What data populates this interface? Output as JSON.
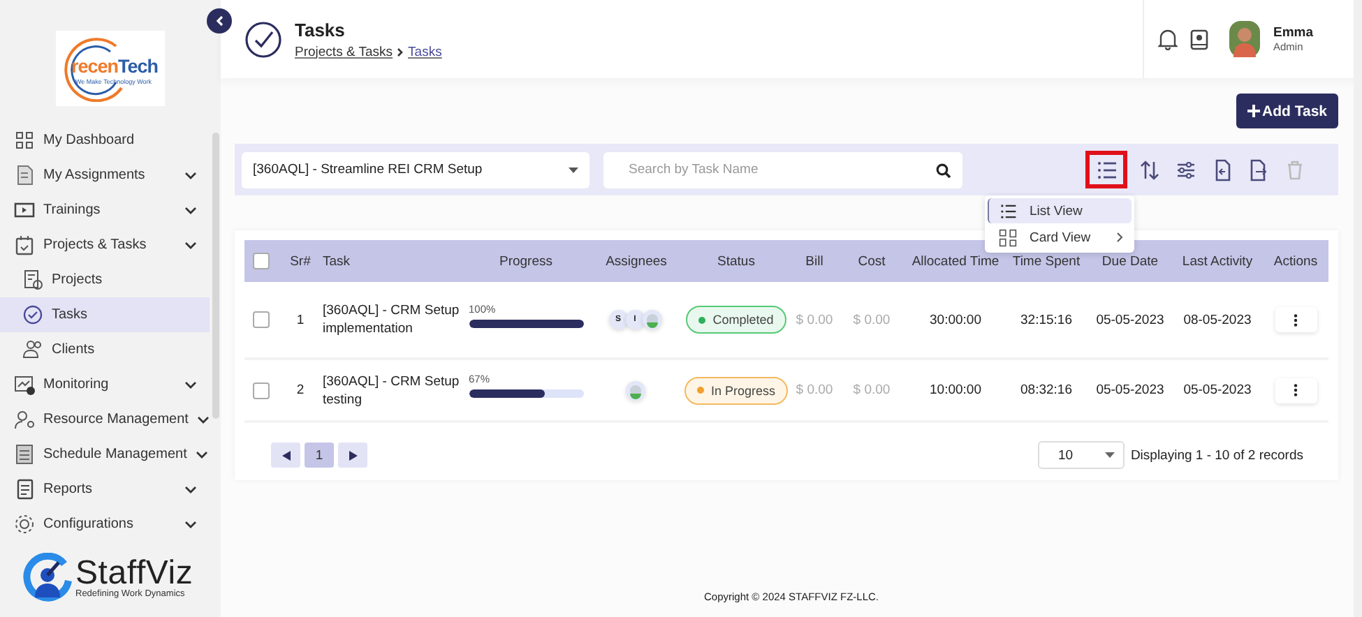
{
  "sidebar": {
    "logo": {
      "name_start": "recen",
      "name_end": "Tech",
      "tagline": "We Make Technology Work"
    },
    "menu": [
      {
        "label": "My Dashboard",
        "has_submenu": false,
        "selected": false
      },
      {
        "label": "My Assignments",
        "has_submenu": true,
        "selected": false
      },
      {
        "label": "Trainings",
        "has_submenu": true,
        "selected": false
      },
      {
        "label": "Projects & Tasks",
        "has_submenu": true,
        "selected": false,
        "children": [
          {
            "label": "Projects",
            "selected": false
          },
          {
            "label": "Tasks",
            "selected": true
          },
          {
            "label": "Clients",
            "selected": false
          }
        ]
      },
      {
        "label": "Monitoring",
        "has_submenu": true,
        "selected": false
      },
      {
        "label": "Resource Management",
        "has_submenu": true,
        "selected": false
      },
      {
        "label": "Schedule Management",
        "has_submenu": true,
        "selected": false
      },
      {
        "label": "Reports",
        "has_submenu": true,
        "selected": false
      },
      {
        "label": "Configurations",
        "has_submenu": true,
        "selected": false
      }
    ],
    "brand": {
      "name": "StaffViz",
      "tagline": "Redefining Work Dynamics"
    }
  },
  "header": {
    "title": "Tasks",
    "breadcrumb": [
      "Projects & Tasks",
      "Tasks"
    ],
    "user": {
      "name": "Emma",
      "role": "Admin"
    }
  },
  "toolbar": {
    "add_button": "Add Task",
    "project_select": "[360AQL] - Streamline REI CRM Setup",
    "search": {
      "placeholder": "Search by Task Name"
    },
    "tools": [
      {
        "kind": "list",
        "highlighted": true,
        "disabled": false
      },
      {
        "kind": "sort",
        "highlighted": false,
        "disabled": false
      },
      {
        "kind": "filter",
        "highlighted": false,
        "disabled": false
      },
      {
        "kind": "import",
        "highlighted": false,
        "disabled": false
      },
      {
        "kind": "export",
        "highlighted": false,
        "disabled": false
      },
      {
        "kind": "delete",
        "highlighted": false,
        "disabled": true
      }
    ]
  },
  "view_menu": [
    {
      "label": "List View",
      "kind": "list",
      "selected": true,
      "has_submenu": false
    },
    {
      "label": "Card View",
      "kind": "card",
      "selected": false,
      "has_submenu": true
    }
  ],
  "table": {
    "select_all": false,
    "columns": [
      "Sr#",
      "Task",
      "Progress",
      "Assignees",
      "Status",
      "Bill",
      "Cost",
      "Allocated Time",
      "Time Spent",
      "Due Date",
      "Last Activity",
      "Actions"
    ],
    "rows": [
      {
        "checked": false,
        "sr": "1",
        "task": "[360AQL] - CRM Setup implementation",
        "progress": {
          "level": 1,
          "reading": "100%"
        },
        "assignees": [
          {
            "kind": "initial",
            "text": "S"
          },
          {
            "kind": "initial",
            "text": "I"
          },
          {
            "kind": "picture"
          }
        ],
        "status": {
          "kind": "completed",
          "label": "Completed"
        },
        "bill": "$ 0.00",
        "cost": "$ 0.00",
        "allocated_time": "30:00:00",
        "time_spent": "32:15:16",
        "due_date": "05-05-2023",
        "last_activity": "08-05-2023"
      },
      {
        "checked": false,
        "sr": "2",
        "task": "[360AQL] - CRM Setup testing",
        "progress": {
          "level": 0.67,
          "reading": "67%"
        },
        "assignees": [
          {
            "kind": "picture"
          }
        ],
        "status": {
          "kind": "in_progress",
          "label": "In Progress"
        },
        "bill": "$ 0.00",
        "cost": "$ 0.00",
        "allocated_time": "10:00:00",
        "time_spent": "08:32:16",
        "due_date": "05-05-2023",
        "last_activity": "05-05-2023"
      }
    ]
  },
  "pagination": {
    "pages": [
      {
        "label": "1",
        "selected": true
      }
    ],
    "page_size": "10",
    "summary": "Displaying 1 - 10 of 2 records"
  },
  "footer": {
    "copyright": "Copyright © 2024 STAFFVIZ FZ-LLC."
  }
}
